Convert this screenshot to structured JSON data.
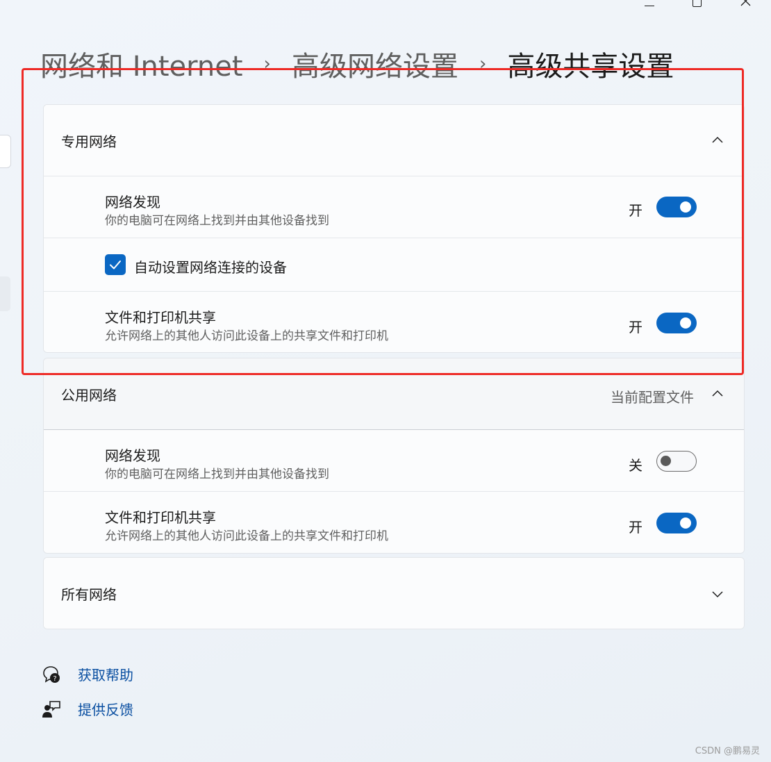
{
  "breadcrumb": {
    "items": [
      "网络和 Internet",
      "高级网络设置",
      "高级共享设置"
    ],
    "separator": "›"
  },
  "private_network": {
    "title": "专用网络",
    "network_discovery": {
      "title": "网络发现",
      "description": "你的电脑可在网络上找到并由其他设备找到",
      "state_label": "开",
      "enabled": true
    },
    "auto_setup": {
      "label": "自动设置网络连接的设备",
      "checked": true
    },
    "file_printer_sharing": {
      "title": "文件和打印机共享",
      "description": "允许网络上的其他人访问此设备上的共享文件和打印机",
      "state_label": "开",
      "enabled": true
    }
  },
  "public_network": {
    "title": "公用网络",
    "profile_label": "当前配置文件",
    "network_discovery": {
      "title": "网络发现",
      "description": "你的电脑可在网络上找到并由其他设备找到",
      "state_label": "关",
      "enabled": false
    },
    "file_printer_sharing": {
      "title": "文件和打印机共享",
      "description": "允许网络上的其他人访问此设备上的共享文件和打印机",
      "state_label": "开",
      "enabled": true
    }
  },
  "all_networks": {
    "title": "所有网络"
  },
  "links": {
    "help": "获取帮助",
    "feedback": "提供反馈"
  },
  "watermark": "CSDN @鹏易灵",
  "colors": {
    "accent": "#0a67c3",
    "highlight_border": "#ee2a26",
    "link": "#0a4fa1"
  }
}
